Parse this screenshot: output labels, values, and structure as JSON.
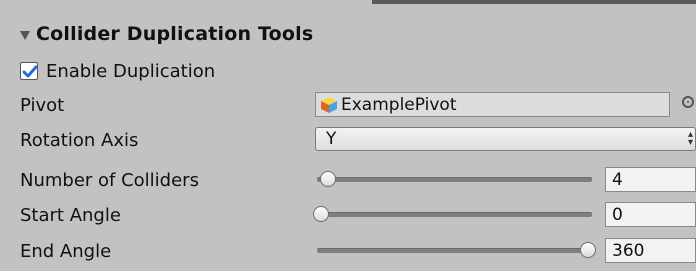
{
  "header": {
    "title": "Collider Duplication Tools"
  },
  "enable": {
    "label": "Enable Duplication",
    "checked": true
  },
  "pivot": {
    "label": "Pivot",
    "value": "ExamplePivot"
  },
  "rotation_axis": {
    "label": "Rotation Axis",
    "value": "Y"
  },
  "sliders": [
    {
      "label": "Number of Colliders",
      "value": "4",
      "fraction": 0.03
    },
    {
      "label": "Start Angle",
      "value": "0",
      "fraction": 0.0
    },
    {
      "label": "End Angle",
      "value": "360",
      "fraction": 1.0
    }
  ],
  "colors": {
    "panel_bg": "#c2c2c2",
    "check_blue": "#2a6bd6"
  }
}
